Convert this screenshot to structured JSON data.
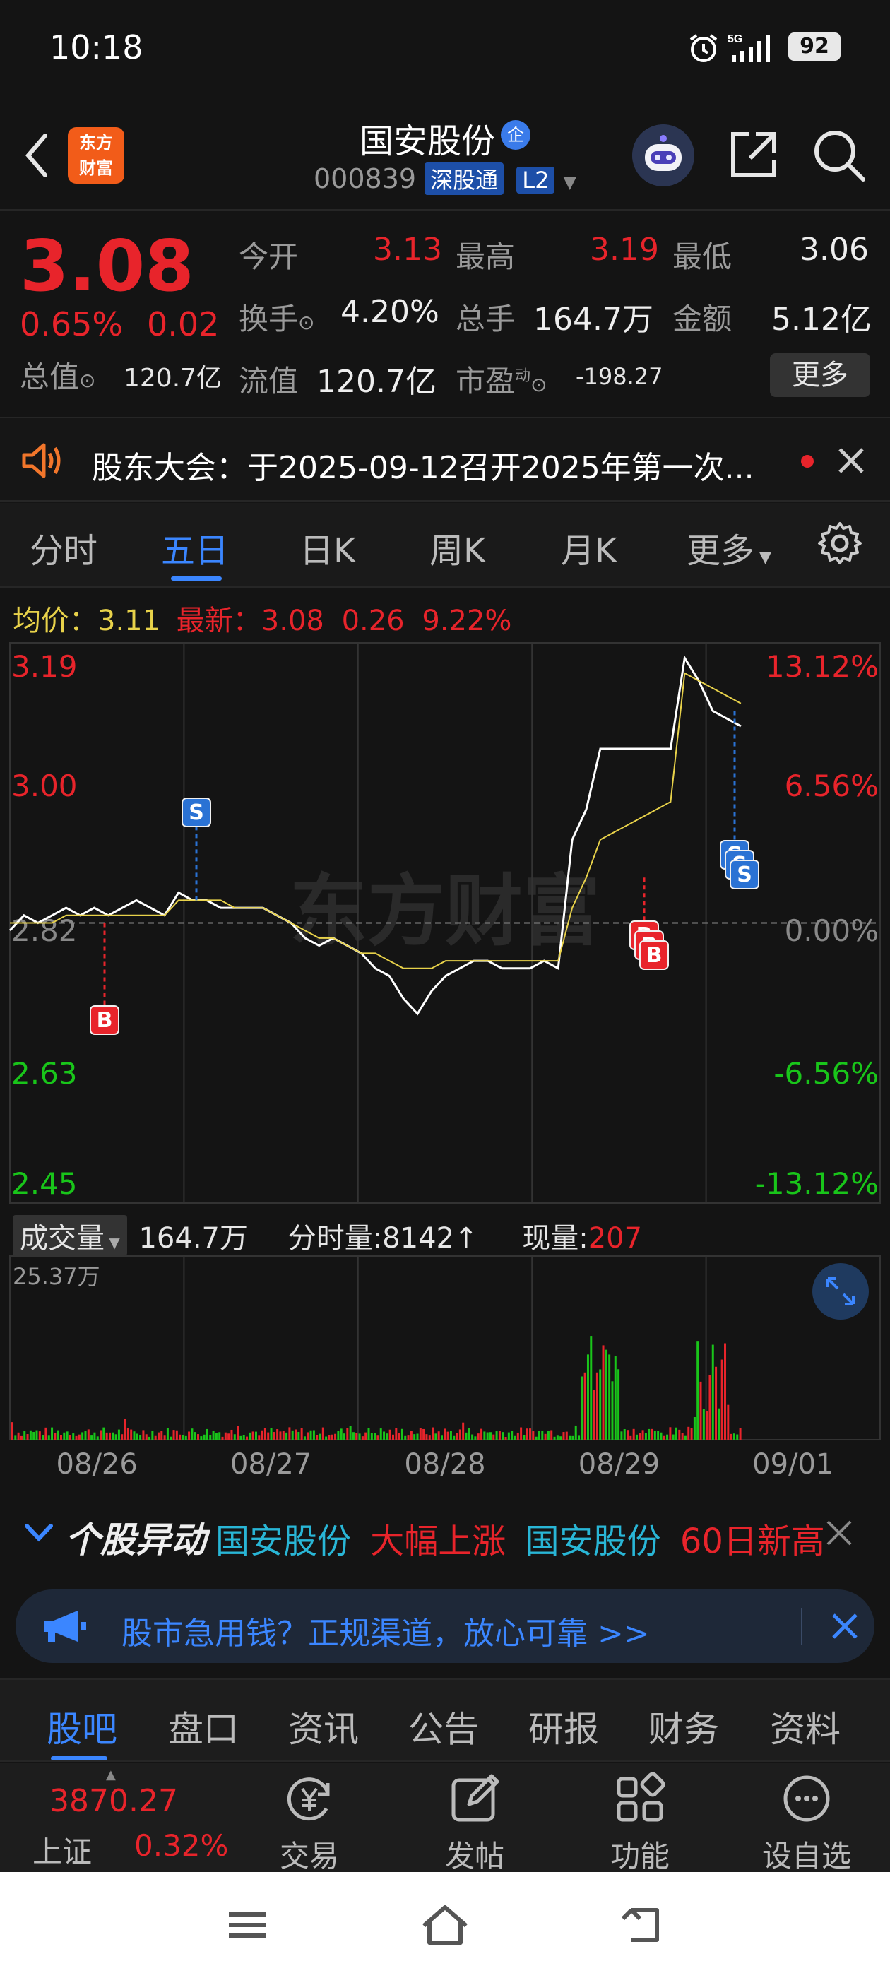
{
  "status_bar": {
    "time": "10:18",
    "battery": "92",
    "network": "5G"
  },
  "header": {
    "logo_line1": "东方",
    "logo_line2": "财富",
    "stock_name": "国安股份",
    "badge": "企",
    "stock_code": "000839",
    "tag_connect": "深股通",
    "tag_level": "L2"
  },
  "quote": {
    "price": "3.08",
    "change_pct": "0.65%",
    "change": "0.02",
    "open_label": "今开",
    "open": "3.13",
    "high_label": "最高",
    "high": "3.19",
    "low_label": "最低",
    "low": "3.06",
    "turnover_label": "换手",
    "turnover": "4.20%",
    "volume_label": "总手",
    "volume": "164.7万",
    "amount_label": "金额",
    "amount": "5.12亿",
    "mktcap_label": "总值",
    "mktcap": "120.7亿",
    "float_label": "流值",
    "float": "120.7亿",
    "pe_label": "市盈",
    "pe_sup": "动",
    "pe": "-198.27",
    "more_label": "更多"
  },
  "announcement": {
    "text": "股东大会：于2025-09-12召开2025年第一次..."
  },
  "period_tabs": [
    "分时",
    "五日",
    "日K",
    "周K",
    "月K",
    "更多"
  ],
  "active_period": "五日",
  "avg_info": {
    "avg_label": "均价：",
    "avg_value": "3.11",
    "latest_label": "最新：",
    "latest_value": "3.08",
    "latest_change": "0.26",
    "latest_pct": "9.22%"
  },
  "chart_data": {
    "type": "line",
    "title": "",
    "price_axis": [
      "3.19",
      "3.00",
      "2.82",
      "2.63",
      "2.45"
    ],
    "pct_axis": [
      "13.12%",
      "6.56%",
      "0.00%",
      "-6.56%",
      "-13.12%"
    ],
    "x_labels": [
      "08/26",
      "08/27",
      "08/28",
      "08/29",
      "09/01"
    ],
    "ylim": [
      2.45,
      3.19
    ],
    "prev_close": 2.82,
    "watermark": "东方财富",
    "series": [
      {
        "name": "price",
        "color": "#ffffff",
        "values": [
          2.81,
          2.83,
          2.82,
          2.83,
          2.84,
          2.83,
          2.84,
          2.83,
          2.84,
          2.85,
          2.84,
          2.83,
          2.86,
          2.85,
          2.85,
          2.84,
          2.84,
          2.84,
          2.84,
          2.83,
          2.82,
          2.8,
          2.79,
          2.8,
          2.79,
          2.78,
          2.76,
          2.75,
          2.72,
          2.7,
          2.73,
          2.75,
          2.76,
          2.77,
          2.77,
          2.76,
          2.76,
          2.76,
          2.77,
          2.76,
          2.93,
          2.97,
          3.05,
          3.05,
          3.05,
          3.05,
          3.05,
          3.05,
          3.17,
          3.14,
          3.1,
          3.09,
          3.08
        ]
      },
      {
        "name": "avg",
        "color": "#e8d24a",
        "values": [
          2.82,
          2.82,
          2.82,
          2.82,
          2.83,
          2.83,
          2.83,
          2.83,
          2.83,
          2.83,
          2.83,
          2.83,
          2.85,
          2.85,
          2.85,
          2.85,
          2.84,
          2.84,
          2.84,
          2.83,
          2.82,
          2.81,
          2.8,
          2.8,
          2.79,
          2.78,
          2.78,
          2.77,
          2.76,
          2.76,
          2.76,
          2.77,
          2.77,
          2.77,
          2.77,
          2.77,
          2.77,
          2.77,
          2.77,
          2.77,
          2.84,
          2.88,
          2.93,
          2.94,
          2.95,
          2.96,
          2.97,
          2.98,
          3.15,
          3.14,
          3.13,
          3.12,
          3.11
        ]
      }
    ],
    "markers": [
      {
        "label": "B",
        "color": "#e8242b"
      },
      {
        "label": "S",
        "color": "#2a72d4"
      },
      {
        "label": "B",
        "color": "#e8242b"
      },
      {
        "label": "S",
        "color": "#2a72d4"
      }
    ]
  },
  "volume": {
    "dropdown_label": "成交量",
    "total": "164.7万",
    "tick_label": "分时量:8142",
    "tick_arrow": "↑",
    "now_label": "现量:",
    "now_value": "207",
    "max_label": "25.37万"
  },
  "anomaly": {
    "title": "个股异动",
    "item1_name": "国安股份",
    "item1_tag": "大幅上涨",
    "item2_name": "国安股份",
    "item2_tag": "60日新高"
  },
  "ad": {
    "text": "股市急用钱？正规渠道，放心可靠 >>"
  },
  "bottom_tabs": [
    "股吧",
    "盘口",
    "资讯",
    "公告",
    "研报",
    "财务",
    "资料"
  ],
  "active_bottom_tab": "股吧",
  "index": {
    "value": "3870.27",
    "name": "上证",
    "pct": "0.32%"
  },
  "actions": [
    "交易",
    "发帖",
    "功能",
    "设自选"
  ]
}
